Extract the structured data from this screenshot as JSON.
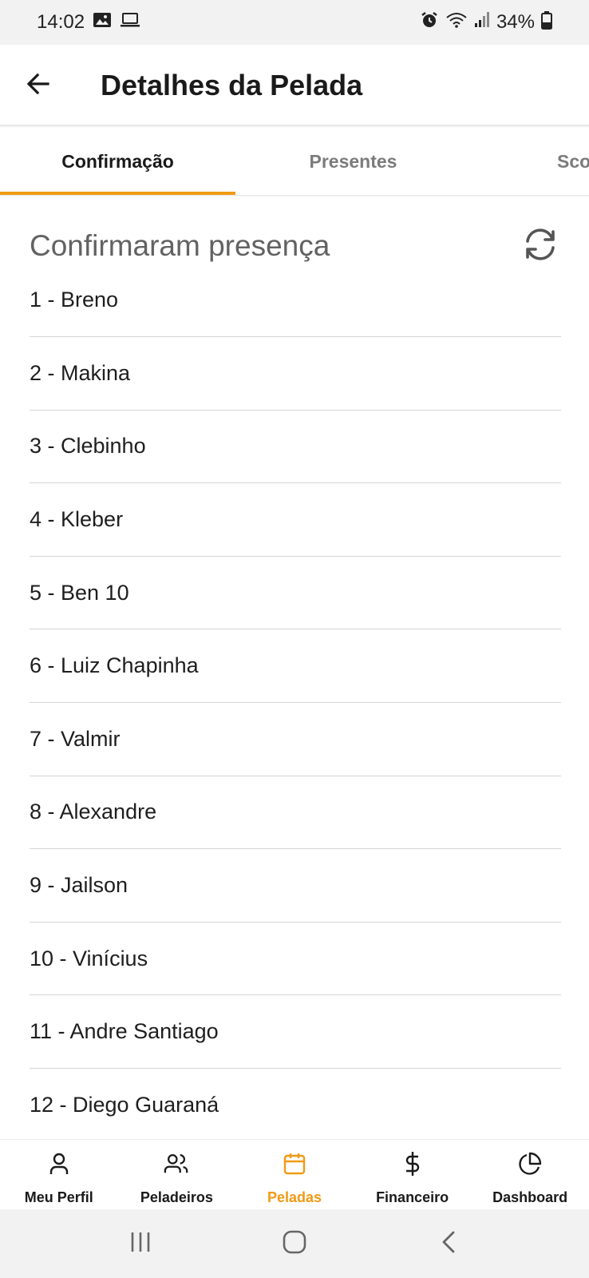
{
  "status_bar": {
    "time": "14:02",
    "battery": "34%",
    "icons": [
      "image-icon",
      "laptop-icon",
      "alarm-icon",
      "wifi-icon",
      "signal-icon",
      "battery-icon"
    ]
  },
  "app_bar": {
    "title": "Detalhes da Pelada",
    "back_icon": "arrow-left-icon"
  },
  "tabs": [
    {
      "label": "Confirmação",
      "active": true
    },
    {
      "label": "Presentes",
      "active": false
    },
    {
      "label": "Sco",
      "active": false
    }
  ],
  "section": {
    "title": "Confirmaram presença",
    "refresh_icon": "refresh-icon"
  },
  "players": [
    "1 - Breno",
    "2 - Makina",
    "3 - Clebinho",
    "4 - Kleber",
    "5 - Ben 10",
    "6 - Luiz Chapinha",
    "7 - Valmir",
    "8 - Alexandre",
    "9 - Jailson",
    "10 - Vinícius",
    "11 - Andre Santiago",
    "12 - Diego Guaraná"
  ],
  "bottom_nav": [
    {
      "label": "Meu Perfil",
      "icon": "user-icon",
      "active": false
    },
    {
      "label": "Peladeiros",
      "icon": "users-icon",
      "active": false
    },
    {
      "label": "Peladas",
      "icon": "calendar-icon",
      "active": true
    },
    {
      "label": "Financeiro",
      "icon": "dollar-icon",
      "active": false
    },
    {
      "label": "Dashboard",
      "icon": "pie-chart-icon",
      "active": false
    }
  ],
  "colors": {
    "accent": "#f09a14",
    "text_primary": "#1a1a1a",
    "text_secondary": "#7b7b7b",
    "divider": "#d6d6d6"
  }
}
